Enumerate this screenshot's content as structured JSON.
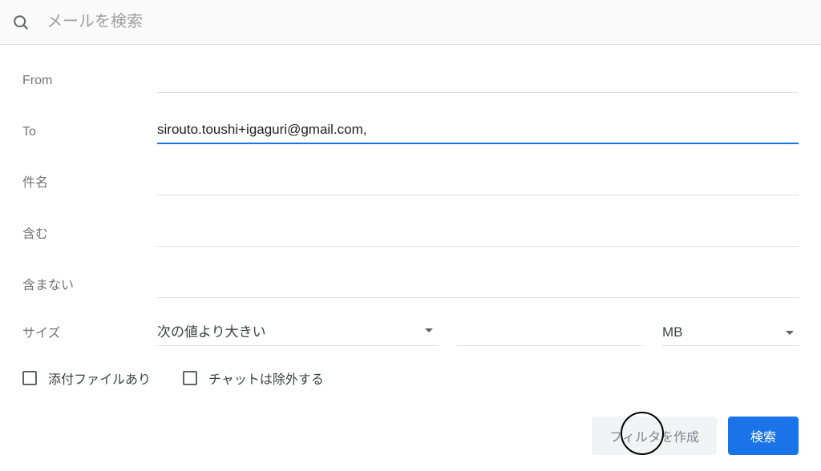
{
  "search": {
    "placeholder": "メールを検索"
  },
  "form": {
    "from_label": "From",
    "from_value": "",
    "to_label": "To",
    "to_value": "sirouto.toushi+igaguri@gmail.com,",
    "subject_label": "件名",
    "subject_value": "",
    "includes_label": "含む",
    "includes_value": "",
    "excludes_label": "含まない",
    "excludes_value": "",
    "size_label": "サイズ",
    "size_compare": "次の値より大きい",
    "size_amount": "",
    "size_unit": "MB"
  },
  "checks": {
    "has_attachment": "添付ファイルあり",
    "exclude_chats": "チャットは除外する"
  },
  "buttons": {
    "create_filter": "フィルタを作成",
    "search": "検索"
  }
}
